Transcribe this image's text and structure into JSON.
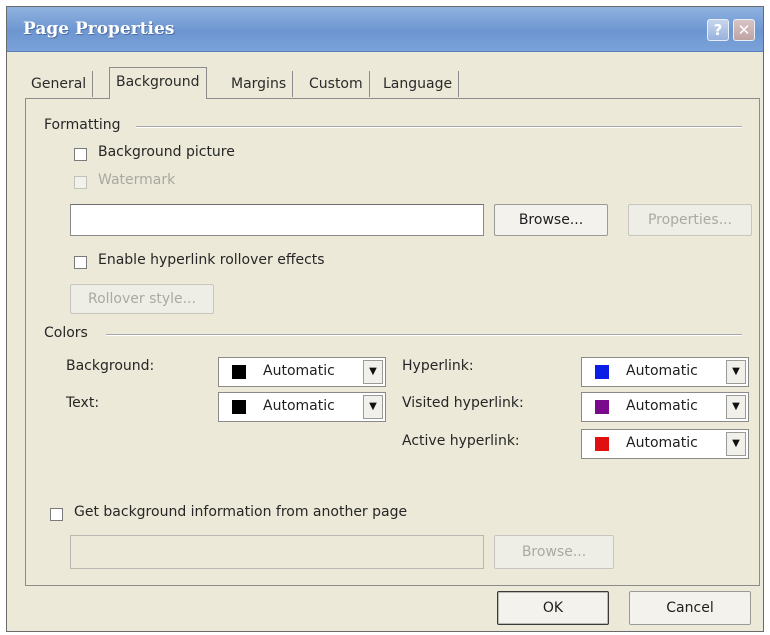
{
  "dialog": {
    "title": "Page Properties",
    "help_glyph": "?",
    "close_glyph": "✕"
  },
  "tabs": [
    {
      "label": "General"
    },
    {
      "label": "Background",
      "active": true
    },
    {
      "label": "Margins"
    },
    {
      "label": "Custom"
    },
    {
      "label": "Language"
    }
  ],
  "formatting": {
    "heading": "Formatting",
    "background_picture": {
      "label": "Background picture",
      "checked": false,
      "enabled": true
    },
    "watermark": {
      "label": "Watermark",
      "checked": false,
      "enabled": false
    },
    "picture_path": {
      "value": ""
    },
    "browse_label": "Browse...",
    "properties_label": "Properties...",
    "rollover_effects": {
      "label": "Enable hyperlink rollover effects",
      "checked": false
    },
    "rollover_style_label": "Rollover style..."
  },
  "colors": {
    "heading": "Colors",
    "left": [
      {
        "label": "Background:",
        "value": "Automatic",
        "swatch": "#000000"
      },
      {
        "label": "Text:",
        "value": "Automatic",
        "swatch": "#000000"
      }
    ],
    "right": [
      {
        "label": "Hyperlink:",
        "value": "Automatic",
        "swatch": "#0a1ee6"
      },
      {
        "label": "Visited hyperlink:",
        "value": "Automatic",
        "swatch": "#7a0a8c"
      },
      {
        "label": "Active hyperlink:",
        "value": "Automatic",
        "swatch": "#e01010"
      }
    ],
    "dropdown_glyph": "▼"
  },
  "other_page": {
    "label": "Get background information from another page",
    "checked": false,
    "path": {
      "value": ""
    },
    "browse_label": "Browse..."
  },
  "footer": {
    "ok_label": "OK",
    "cancel_label": "Cancel"
  }
}
